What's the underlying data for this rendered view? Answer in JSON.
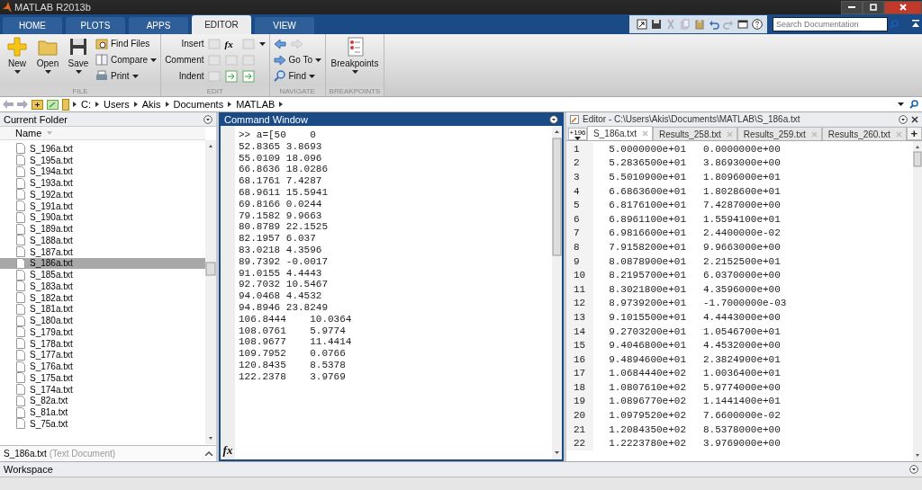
{
  "window": {
    "title": "MATLAB R2013b"
  },
  "tabs": [
    {
      "label": "HOME",
      "selected": false
    },
    {
      "label": "PLOTS",
      "selected": false
    },
    {
      "label": "APPS",
      "selected": false
    },
    {
      "label": "EDITOR",
      "selected": true
    },
    {
      "label": "VIEW",
      "selected": false
    }
  ],
  "search": {
    "placeholder": "Search Documentation"
  },
  "ribbon": {
    "groups": [
      {
        "label": "FILE",
        "large": [
          "New",
          "Open",
          "Save"
        ],
        "small": [
          "Find Files",
          "Compare",
          "Print"
        ]
      },
      {
        "label": "EDIT",
        "small": [
          "Insert",
          "Comment",
          "Indent"
        ],
        "glyph": "fx"
      },
      {
        "label": "NAVIGATE",
        "small": [
          "Go To",
          "Find"
        ]
      },
      {
        "label": "BREAKPOINTS",
        "large": [
          "Breakpoints"
        ]
      }
    ]
  },
  "address": {
    "path": [
      "C:",
      "Users",
      "Akis",
      "Documents",
      "MATLAB"
    ]
  },
  "current_folder": {
    "title": "Current Folder",
    "column": "Name",
    "files": [
      {
        "name": "S_196a.txt",
        "selected": false
      },
      {
        "name": "S_195a.txt",
        "selected": false
      },
      {
        "name": "S_194a.txt",
        "selected": false
      },
      {
        "name": "S_193a.txt",
        "selected": false
      },
      {
        "name": "S_192a.txt",
        "selected": false
      },
      {
        "name": "S_191a.txt",
        "selected": false
      },
      {
        "name": "S_190a.txt",
        "selected": false
      },
      {
        "name": "S_189a.txt",
        "selected": false
      },
      {
        "name": "S_188a.txt",
        "selected": false
      },
      {
        "name": "S_187a.txt",
        "selected": false
      },
      {
        "name": "S_186a.txt",
        "selected": true
      },
      {
        "name": "S_185a.txt",
        "selected": false
      },
      {
        "name": "S_183a.txt",
        "selected": false
      },
      {
        "name": "S_182a.txt",
        "selected": false
      },
      {
        "name": "S_181a.txt",
        "selected": false
      },
      {
        "name": "S_180a.txt",
        "selected": false
      },
      {
        "name": "S_179a.txt",
        "selected": false
      },
      {
        "name": "S_178a.txt",
        "selected": false
      },
      {
        "name": "S_177a.txt",
        "selected": false
      },
      {
        "name": "S_176a.txt",
        "selected": false
      },
      {
        "name": "S_175a.txt",
        "selected": false
      },
      {
        "name": "S_174a.txt",
        "selected": false
      },
      {
        "name": "S_82a.txt",
        "selected": false
      },
      {
        "name": "S_81a.txt",
        "selected": false
      },
      {
        "name": "S_75a.txt",
        "selected": false
      }
    ],
    "details_name": "S_186a.txt",
    "details_type": "(Text Document)"
  },
  "command_window": {
    "title": "Command Window",
    "prompt_glyph": "fx",
    "lines": [
      ">> a=[50    0",
      "52.8365 3.8693",
      "55.0109 18.096",
      "66.8636 18.0286",
      "68.1761 7.4287",
      "68.9611 15.5941",
      "69.8166 0.0244",
      "79.1582 9.9663",
      "80.8789 22.1525",
      "82.1957 6.037",
      "83.0218 4.3596",
      "89.7392 -0.0017",
      "91.0155 4.4443",
      "92.7032 10.5467",
      "94.0468 4.4532",
      "94.8946 23.8249",
      "106.8444    10.0364",
      "108.0761    5.9774",
      "108.9677    11.4414",
      "109.7952    0.0766",
      "120.8435    8.5378",
      "122.2378    3.9769"
    ]
  },
  "editor": {
    "title": "Editor - C:\\Users\\Akis\\Documents\\MATLAB\\S_186a.txt",
    "overflow": "+196",
    "add": "+",
    "tabs": [
      {
        "label": "S_186a.txt",
        "selected": true
      },
      {
        "label": "Results_258.txt",
        "selected": false
      },
      {
        "label": "Results_259.txt",
        "selected": false
      },
      {
        "label": "Results_260.txt",
        "selected": false
      }
    ],
    "rows": [
      {
        "line": "1",
        "x": "5.0000000e+01",
        "y": "0.0000000e+00"
      },
      {
        "line": "2",
        "x": "5.2836500e+01",
        "y": "3.8693000e+00"
      },
      {
        "line": "3",
        "x": "5.5010900e+01",
        "y": "1.8096000e+01"
      },
      {
        "line": "4",
        "x": "6.6863600e+01",
        "y": "1.8028600e+01"
      },
      {
        "line": "5",
        "x": "6.8176100e+01",
        "y": "7.4287000e+00"
      },
      {
        "line": "6",
        "x": "6.8961100e+01",
        "y": "1.5594100e+01"
      },
      {
        "line": "7",
        "x": "6.9816600e+01",
        "y": "2.4400000e-02"
      },
      {
        "line": "8",
        "x": "7.9158200e+01",
        "y": "9.9663000e+00"
      },
      {
        "line": "9",
        "x": "8.0878900e+01",
        "y": "2.2152500e+01"
      },
      {
        "line": "10",
        "x": "8.2195700e+01",
        "y": "6.0370000e+00"
      },
      {
        "line": "11",
        "x": "8.3021800e+01",
        "y": "4.3596000e+00"
      },
      {
        "line": "12",
        "x": "8.9739200e+01",
        "y": "-1.7000000e-03"
      },
      {
        "line": "13",
        "x": "9.1015500e+01",
        "y": "4.4443000e+00"
      },
      {
        "line": "14",
        "x": "9.2703200e+01",
        "y": "1.0546700e+01"
      },
      {
        "line": "15",
        "x": "9.4046800e+01",
        "y": "4.4532000e+00"
      },
      {
        "line": "16",
        "x": "9.4894600e+01",
        "y": "2.3824900e+01"
      },
      {
        "line": "17",
        "x": "1.0684440e+02",
        "y": "1.0036400e+01"
      },
      {
        "line": "18",
        "x": "1.0807610e+02",
        "y": "5.9774000e+00"
      },
      {
        "line": "19",
        "x": "1.0896770e+02",
        "y": "1.1441400e+01"
      },
      {
        "line": "20",
        "x": "1.0979520e+02",
        "y": "7.6600000e-02"
      },
      {
        "line": "21",
        "x": "1.2084350e+02",
        "y": "8.5378000e+00"
      },
      {
        "line": "22",
        "x": "1.2223780e+02",
        "y": "3.9769000e+00"
      }
    ]
  },
  "workspace": {
    "title": "Workspace"
  }
}
